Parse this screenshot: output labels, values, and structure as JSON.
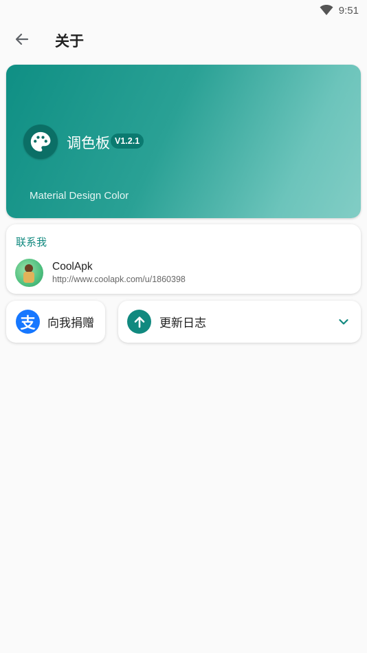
{
  "status_bar": {
    "time": "9:51",
    "wifi_icon": "wifi-icon"
  },
  "app_bar": {
    "back_icon": "arrow-back-icon",
    "title": "关于"
  },
  "hero": {
    "logo_icon": "palette-icon",
    "app_name": "调色板",
    "version": "V1.2.1",
    "subtitle": "Material Design Color",
    "colors": {
      "gradient_start": "#0f8f84",
      "gradient_end": "#82cdc5"
    }
  },
  "contact": {
    "header": "联系我",
    "items": [
      {
        "name": "CoolApk",
        "url": "http://www.coolapk.com/u/1860398",
        "icon": "avatar"
      }
    ]
  },
  "donate": {
    "icon": "alipay-icon",
    "icon_glyph": "支",
    "label": "向我捐赠"
  },
  "changelog": {
    "icon": "arrow-up-icon",
    "label": "更新日志",
    "expand_icon": "chevron-down-icon"
  },
  "theme": {
    "accent": "#11897f",
    "alipay_blue": "#1677ff"
  }
}
